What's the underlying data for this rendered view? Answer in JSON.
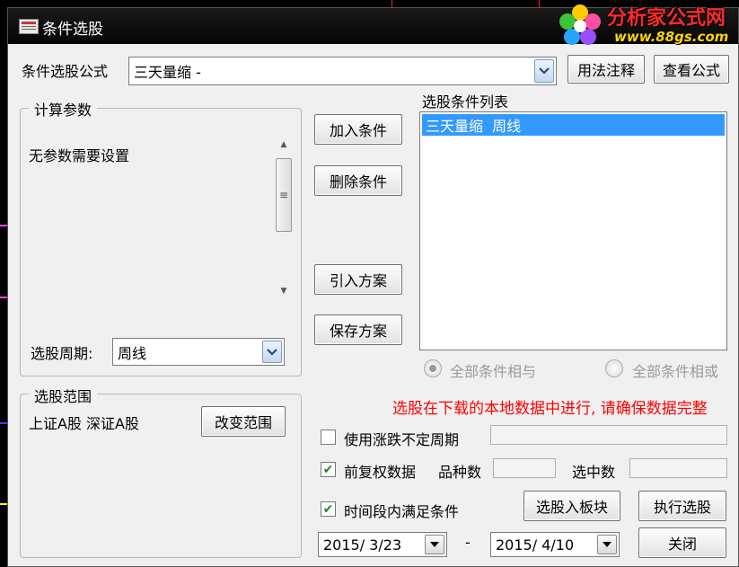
{
  "window": {
    "title": "条件选股"
  },
  "watermark": {
    "title": "分析家公式网",
    "url": "www.88gs.com"
  },
  "formula": {
    "label": "条件选股公式",
    "selected": "三天量缩 -",
    "usage_button": "用法注释",
    "view_button": "查看公式"
  },
  "params": {
    "title": "计算参数",
    "text": "无参数需要设置",
    "period_label": "选股周期:",
    "period_value": "周线"
  },
  "actions": {
    "add": "加入条件",
    "delete": "删除条件",
    "import": "引入方案",
    "save": "保存方案"
  },
  "conditions": {
    "title": "选股条件列表",
    "items": [
      "三天量缩  周线"
    ],
    "all_and": "全部条件相与",
    "all_or": "全部条件相或"
  },
  "range": {
    "title": "选股范围",
    "text": "上证A股 深证A股",
    "change_button": "改变范围"
  },
  "warning": {
    "text": "选股在下载的本地数据中进行, 请确保数据完整",
    "color": "#ff0000"
  },
  "options": {
    "variable_period": {
      "label": "使用涨跌不定周期",
      "checked": false
    },
    "pre_adjusted": {
      "label": "前复权数据",
      "checked": true
    },
    "varieties_label": "品种数",
    "selected_label": "选中数",
    "time_period": {
      "label": "时间段内满足条件",
      "checked": true
    }
  },
  "dates": {
    "start": "2015/ 3/23",
    "separator": "-",
    "end": "2015/ 4/10"
  },
  "bottom_buttons": {
    "to_block": "选股入板块",
    "execute": "执行选股",
    "close": "关闭"
  }
}
